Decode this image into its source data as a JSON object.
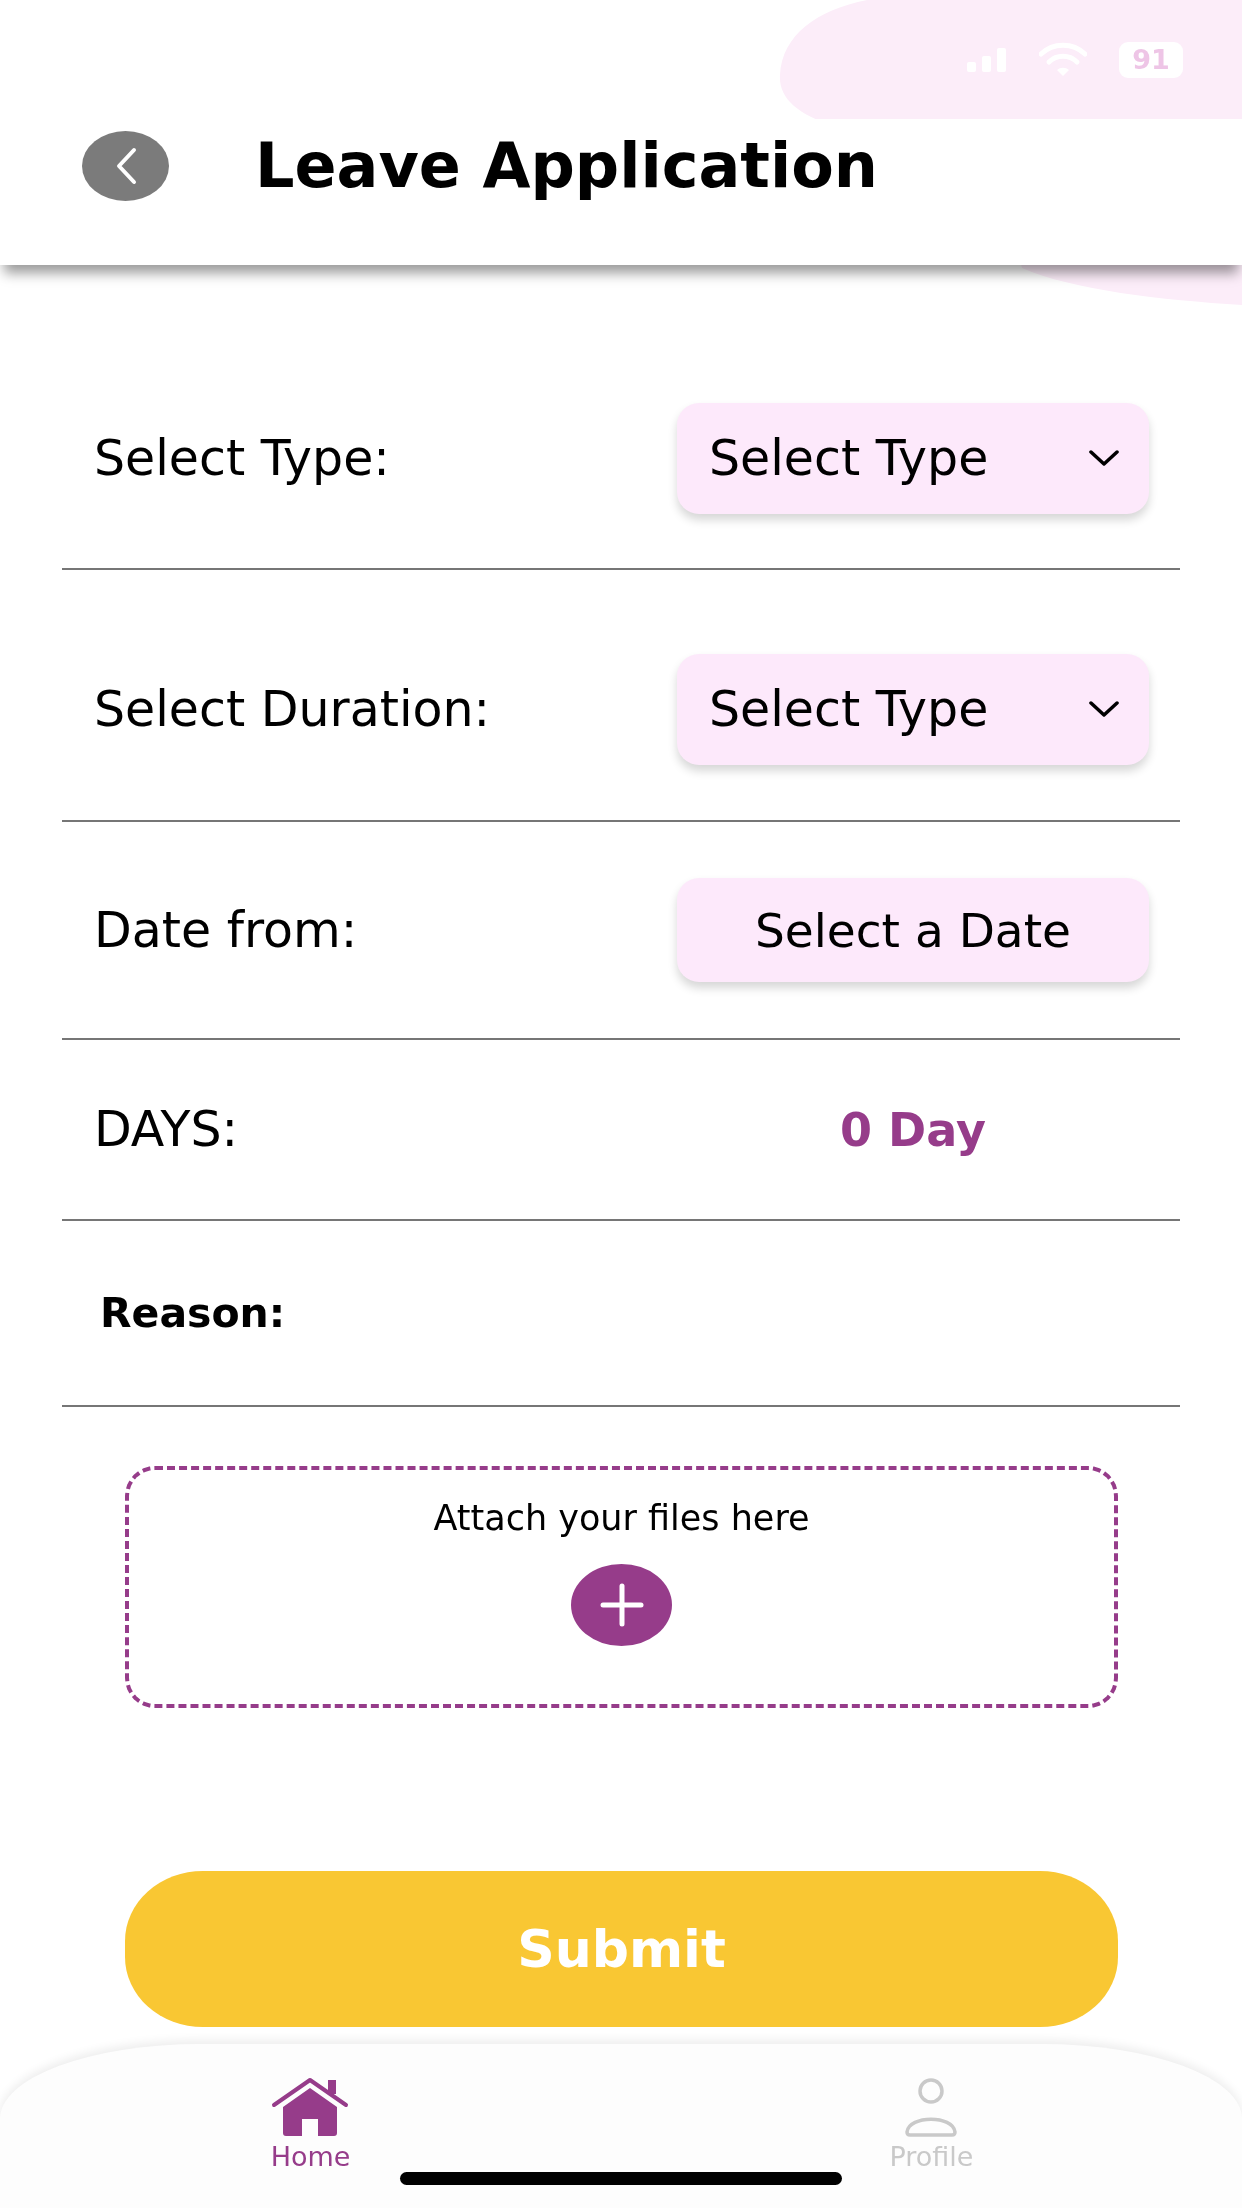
{
  "status_bar": {
    "battery": "91"
  },
  "header": {
    "title": "Leave Application"
  },
  "form": {
    "rows": [
      {
        "kind": "dropdown",
        "label": "Select Type:",
        "value": "Select Type"
      },
      {
        "kind": "dropdown",
        "label": "Select Duration:",
        "value": "Select Type"
      },
      {
        "kind": "date",
        "label": "Date from:",
        "value": "Select a Date"
      },
      {
        "kind": "readout",
        "label": "DAYS:",
        "value": "0 Day"
      },
      {
        "kind": "heading",
        "label": "Reason:"
      }
    ]
  },
  "attachment": {
    "prompt": "Attach your files here"
  },
  "submit": {
    "label": "Submit"
  },
  "tab_bar": {
    "tabs": [
      {
        "kind": "home",
        "label": "Home",
        "selected": true
      },
      {
        "kind": "profile",
        "label": "Profile",
        "selected": false
      }
    ]
  }
}
